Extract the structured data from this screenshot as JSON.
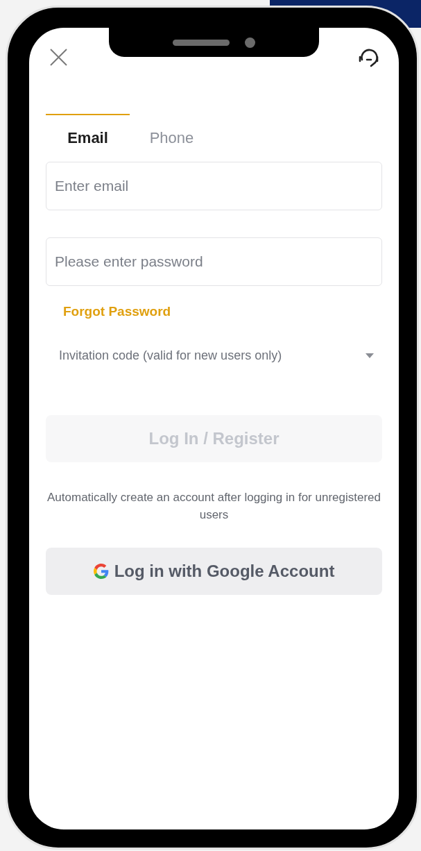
{
  "tabs": [
    {
      "label": "Email",
      "selected": true
    },
    {
      "label": "Phone",
      "selected": false
    }
  ],
  "email_field": {
    "placeholder": "Enter email"
  },
  "password_field": {
    "placeholder": "Please enter password"
  },
  "forgot_password": "Forgot Password",
  "invitation_code": {
    "placeholder": "Invitation code (valid for new users only)",
    "expanded": false
  },
  "login_button": {
    "label": "Log In / Register",
    "disabled": true
  },
  "note": "Automatically create an account after logging in for unregistered users",
  "google_button": {
    "label": "Log in with Google Account"
  }
}
